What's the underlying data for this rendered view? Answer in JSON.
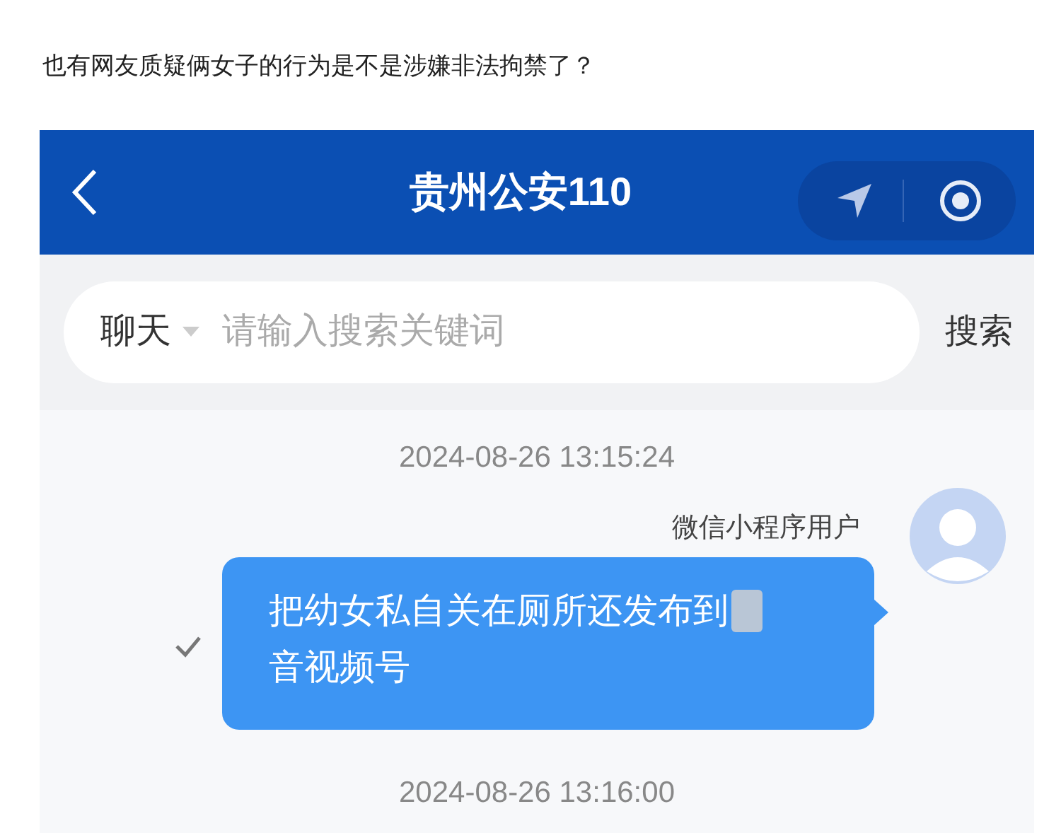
{
  "caption": "也有网友质疑俩女子的行为是不是涉嫌非法拘禁了？",
  "app": {
    "title": "贵州公安110",
    "search": {
      "scope": "聊天",
      "placeholder": "请输入搜索关键词",
      "button": "搜索"
    },
    "messages": [
      {
        "kind": "time",
        "text": "2024-08-26 13:15:24"
      },
      {
        "kind": "message",
        "sender": "微信小程序用户",
        "lines": [
          "把幼女私自关在厕所还发布到",
          "音视频号"
        ],
        "redacted": true,
        "read": true
      },
      {
        "kind": "time",
        "text": "2024-08-26 13:16:00"
      }
    ]
  }
}
